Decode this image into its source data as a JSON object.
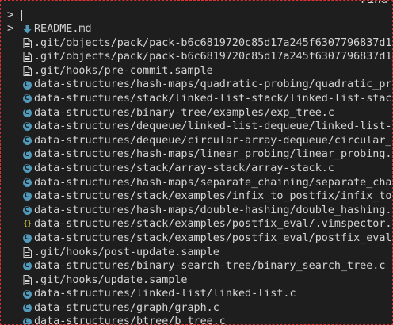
{
  "find_label": "Find",
  "prompt": {
    "chevron": ">",
    "query": ""
  },
  "selection_marker": ">",
  "colors": {
    "background": "#1e1e1e",
    "text": "#d4d4d4",
    "c_icon": "#519aba",
    "json_icon": "#cbcb41",
    "md_icon": "#519aba",
    "border": "#e03030"
  },
  "results": [
    {
      "icon": "markdown-icon",
      "path": "README.md",
      "selected": true
    },
    {
      "icon": "file-icon",
      "path": ".git/objects/pack/pack-b6c6819720c85d17a245f6307796837d1"
    },
    {
      "icon": "file-icon",
      "path": ".git/objects/pack/pack-b6c6819720c85d17a245f6307796837d1"
    },
    {
      "icon": "file-icon",
      "path": ".git/hooks/pre-commit.sample"
    },
    {
      "icon": "c-file-icon",
      "path": "data-structures/hash-maps/quadratic-probing/quadratic_pr"
    },
    {
      "icon": "c-file-icon",
      "path": "data-structures/stack/linked-list-stack/linked-list-stac"
    },
    {
      "icon": "c-file-icon",
      "path": "data-structures/binary-tree/examples/exp_tree.c"
    },
    {
      "icon": "c-file-icon",
      "path": "data-structures/dequeue/linked-list-dequeue/linked-list-"
    },
    {
      "icon": "c-file-icon",
      "path": "data-structures/dequeue/circular-array-dequeue/circular_"
    },
    {
      "icon": "c-file-icon",
      "path": "data-structures/hash-maps/linear_probing/linear_probing."
    },
    {
      "icon": "c-file-icon",
      "path": "data-structures/stack/array-stack/array-stack.c"
    },
    {
      "icon": "c-file-icon",
      "path": "data-structures/hash-maps/separate_chaining/separate_cha"
    },
    {
      "icon": "c-file-icon",
      "path": "data-structures/stack/examples/infix_to_postfix/infix_to"
    },
    {
      "icon": "c-file-icon",
      "path": "data-structures/hash-maps/double-hashing/double_hashing."
    },
    {
      "icon": "json-icon",
      "path": "data-structures/stack/examples/postfix_eval/.vimspector."
    },
    {
      "icon": "c-file-icon",
      "path": "data-structures/stack/examples/postfix_eval/postfix_eval"
    },
    {
      "icon": "file-icon",
      "path": ".git/hooks/post-update.sample"
    },
    {
      "icon": "c-file-icon",
      "path": "data-structures/binary-search-tree/binary_search_tree.c"
    },
    {
      "icon": "file-icon",
      "path": ".git/hooks/update.sample"
    },
    {
      "icon": "c-file-icon",
      "path": "data-structures/linked-list/linked-list.c"
    },
    {
      "icon": "c-file-icon",
      "path": "data-structures/graph/graph.c"
    },
    {
      "icon": "c-file-icon",
      "path": "data-structures/btree/b_tree.c"
    }
  ]
}
